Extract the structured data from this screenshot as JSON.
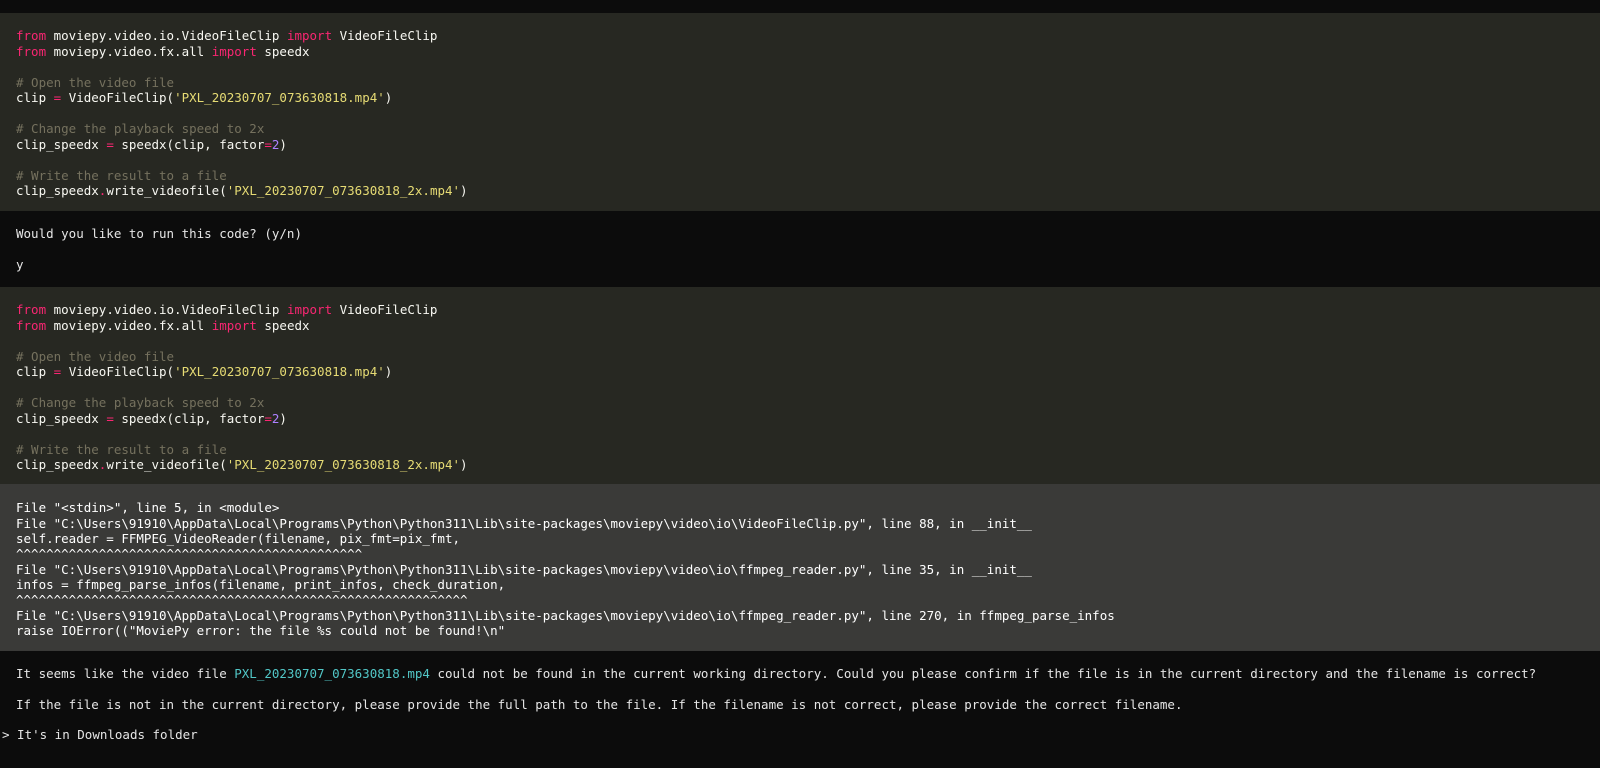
{
  "code_block_1": {
    "lines": [
      {
        "kw1": "from",
        "mod": " moviepy.video.io.VideoFileClip ",
        "kw2": "import",
        "name": " VideoFileClip"
      },
      {
        "kw1": "from",
        "mod": " moviepy.video.fx.all ",
        "kw2": "import",
        "name": " speedx"
      },
      {
        "comment": "# Open the video file"
      },
      {
        "lhs": "clip ",
        "op": "=",
        "call": " VideoFileClip(",
        "str": "'PXL_20230707_073630818.mp4'",
        "end": ")"
      },
      {
        "comment": "# Change the playback speed to 2x"
      },
      {
        "lhs": "clip_speedx ",
        "op": "=",
        "call": " speedx(clip, factor",
        "op2": "=",
        "num": "2",
        "end": ")"
      },
      {
        "comment": "# Write the result to a file"
      },
      {
        "obj": "clip_speedx",
        "dot": ".",
        "call": "write_videofile(",
        "str": "'PXL_20230707_073630818_2x.mp4'",
        "end": ")"
      }
    ]
  },
  "prompt": {
    "question": "Would you like to run this code? (y/n)",
    "answer": "y"
  },
  "error_block": {
    "lines": [
      "File \"<stdin>\", line 5, in <module>",
      "File \"C:\\Users\\91910\\AppData\\Local\\Programs\\Python\\Python311\\Lib\\site-packages\\moviepy\\video\\io\\VideoFileClip.py\", line 88, in __init__",
      "self.reader = FFMPEG_VideoReader(filename, pix_fmt=pix_fmt,",
      "^^^^^^^^^^^^^^^^^^^^^^^^^^^^^^^^^^^^^^^^^^^^^^",
      "File \"C:\\Users\\91910\\AppData\\Local\\Programs\\Python\\Python311\\Lib\\site-packages\\moviepy\\video\\io\\ffmpeg_reader.py\", line 35, in __init__",
      "infos = ffmpeg_parse_infos(filename, print_infos, check_duration,",
      "^^^^^^^^^^^^^^^^^^^^^^^^^^^^^^^^^^^^^^^^^^^^^^^^^^^^^^^^^^^^",
      "File \"C:\\Users\\91910\\AppData\\Local\\Programs\\Python\\Python311\\Lib\\site-packages\\moviepy\\video\\io\\ffmpeg_reader.py\", line 270, in ffmpeg_parse_infos",
      "raise IOError((\"MoviePy error: the file %s could not be found!\\n\""
    ]
  },
  "assistant_reply": {
    "p1_before": "It seems like the video file ",
    "p1_file": "PXL_20230707_073630818.mp4",
    "p1_after": " could not be found in the current working directory. Could you please confirm if the file is in the current directory and the filename is correct?",
    "p2": "If the file is not in the current directory, please provide the full path to the file. If the filename is not correct, please provide the correct filename."
  },
  "user_input": {
    "caret": ">",
    "text": " It's in Downloads folder"
  }
}
